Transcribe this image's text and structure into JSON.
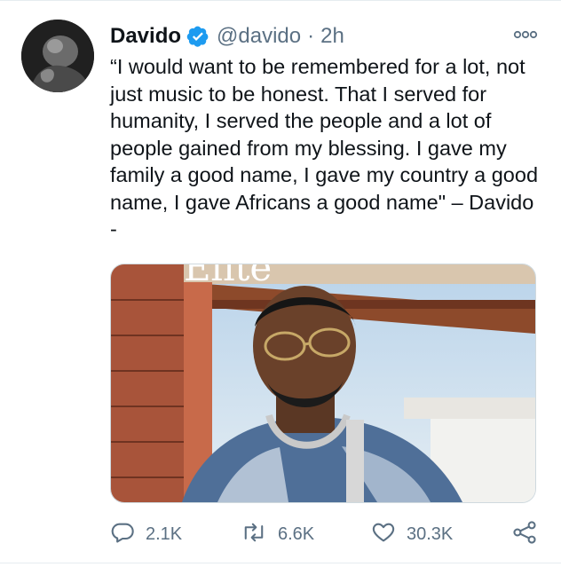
{
  "tweet": {
    "display_name": "Davido",
    "handle": "@davido",
    "separator": "·",
    "time": "2h",
    "text": "“I would want to be remembered for a lot, not just music to be honest. That I served for humanity, I served the people and a lot of people gained from my blessing. I gave my family a good name, I gave my country a good name, I gave Africans a good name\" – Davido -",
    "media_overlay_text": "Elite"
  },
  "metrics": {
    "replies": "2.1K",
    "retweets": "6.6K",
    "likes": "30.3K"
  },
  "icons": {
    "avatar": "profile-photo",
    "verified": "verified-badge-icon",
    "more": "more-options-icon",
    "reply": "reply-icon",
    "retweet": "retweet-icon",
    "like": "heart-icon",
    "share": "share-icon"
  },
  "colors": {
    "verified_blue": "#1d9bf0",
    "text": "#0f1419",
    "secondary": "#5b7083"
  }
}
